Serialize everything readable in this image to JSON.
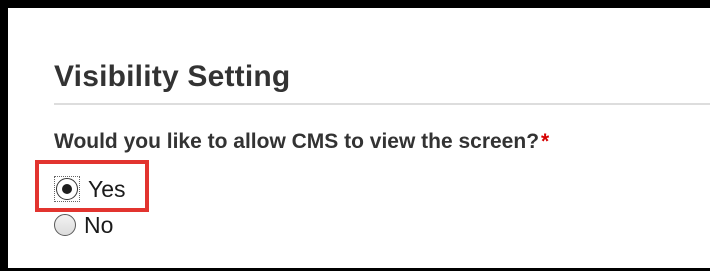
{
  "section": {
    "title": "Visibility Setting"
  },
  "question": {
    "text": "Would you like to allow CMS to view the screen?",
    "required_marker": "*"
  },
  "options": [
    {
      "label": "Yes",
      "selected": true
    },
    {
      "label": "No",
      "selected": false
    }
  ],
  "colors": {
    "frame_border": "#000000",
    "heading_text": "#333333",
    "required_marker": "#d50000",
    "highlight_box": "#e2342f"
  }
}
